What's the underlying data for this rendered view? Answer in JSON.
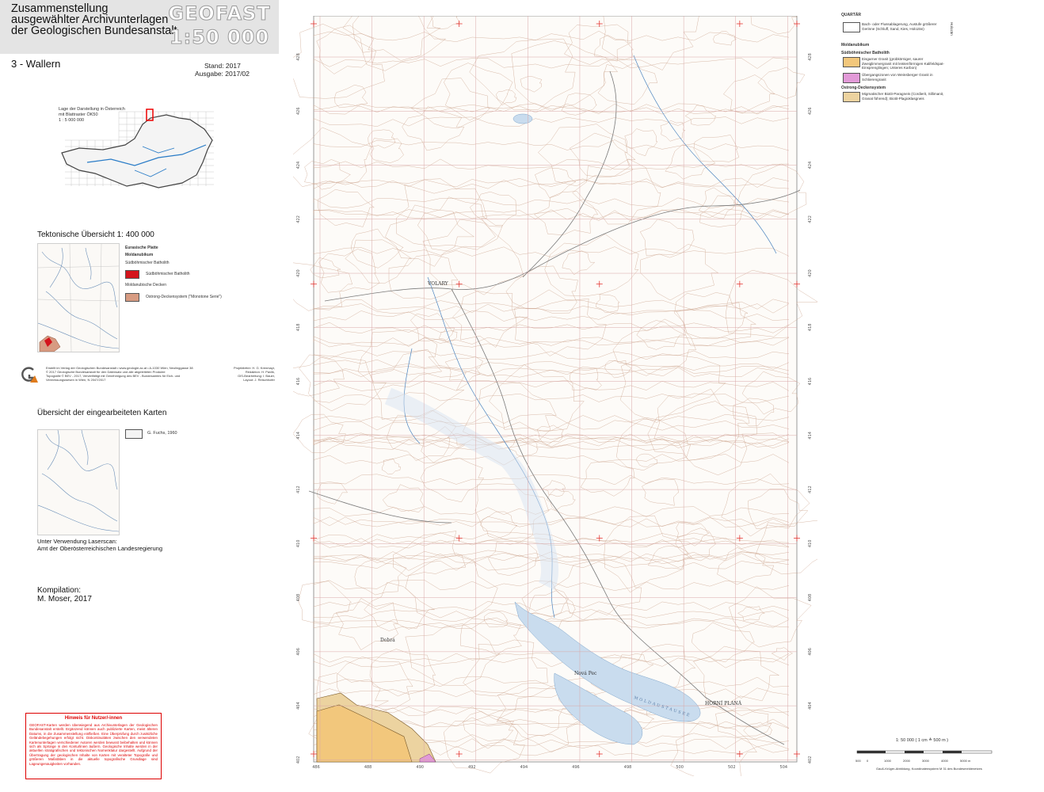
{
  "header": {
    "title_lines": [
      "Zusammenstellung",
      "ausgewählter Archivunterlagen",
      "der Geologischen Bundesanstalt"
    ],
    "brand_top": "GEOFAST",
    "brand_bottom": "1:50 000"
  },
  "sheet": {
    "name": "3 - Wallern",
    "stand": "Stand: 2017",
    "ausgabe": "Ausgabe: 2017/02"
  },
  "location_map": {
    "caption_lines": [
      "Lage der Darstellung in Österreich",
      "mit Blattraster ÖK50",
      "1 : 5 000 000"
    ]
  },
  "tectonic": {
    "title": "Tektonische Übersicht  1: 400 000",
    "legend": [
      {
        "label": "Eurasische Platte",
        "kind": "heading"
      },
      {
        "label": "Moldanubikum",
        "kind": "heading"
      },
      {
        "label": "Südböhmischer Batholith",
        "kind": "sub"
      },
      {
        "label": "Südböhmischer Batholith",
        "kind": "swatch",
        "color": "#d4141c"
      },
      {
        "label": "Moldanubische Decken",
        "kind": "sub"
      },
      {
        "label": "Ostrong-Deckensystem (\"Monotone Serie\")",
        "kind": "swatch",
        "color": "#d79b82"
      }
    ]
  },
  "imprint": {
    "left_lines": [
      "Erstellt im Verlag der Geologischen Bundesanstalt • www.geologie.ac.at • A-1030 Wien, Neulinggasse 38",
      "© 2017 Geologische Bundesanstalt für den Datensatz und alle abgeleiteten Produkte",
      "Topografie © BEV - 2017, Vervielfältigt mit Genehmigung des BEV - Bundesamtes für Eich- und",
      "Vermessungswesen in Wien, N 2047/2017"
    ],
    "right_lines": [
      "Projektleiter: H. G. Krenmayr,",
      "Redaktion: H. Pavlik,",
      "GIS-Bearbeitung: I. Bauer,",
      "Layout: J. Reischhofer"
    ]
  },
  "overview": {
    "title": "Übersicht der eingearbeiteten Karten",
    "legend_label": "G. Fuchs, 1960",
    "laser_lines": [
      "Unter Verwendung Laserscan:",
      "Amt der Oberösterreichischen Landesregierung"
    ]
  },
  "compilation": {
    "label": "Kompilation:",
    "author": "M. Moser, 2017"
  },
  "notice": {
    "title": "Hinweis für Nutzer/-innen",
    "body": "GEOFAST-Karten werden überwiegend aus Archivunterlagen der Geologischen Bundesanstalt erstellt. Ergänzend können auch publizierte Karten, meist älteren Datums, in die Zusammenstellung einfließen. Eine Überprüfung durch zusätzliche Geländebegehungen erfolgt nicht. Diskontinuitäten zwischen den verwendeten Kartenunterlagen verschiedener Autoren werden bewusst beibehalten und können sich als Sprünge in den Konturlinien äußern. Geologische Inhalte werden in der aktuellen stratigrafischen und tektonischen Nomenklatur dargestellt. Aufgrund der Übertragung der geologischen Inhalte von Karten mit veralteter Topografie und größeren Maßstäben in die aktuelle topografische Grundlage sind Lageungenauigkeiten vorhanden."
  },
  "map": {
    "easting_labels": [
      "486",
      "488",
      "490",
      "492",
      "494",
      "496",
      "498",
      "500",
      "502",
      "504"
    ],
    "northing_labels": [
      "428",
      "426",
      "424",
      "422",
      "420",
      "418",
      "416",
      "414",
      "412",
      "410",
      "408",
      "406",
      "404",
      "402"
    ],
    "place_names": [
      "VOLARY",
      "HORNÍ PLANÁ",
      "MOLDAUSTAUSEE",
      "Nová Pec",
      "Dobrá"
    ]
  },
  "legend": {
    "quartar_title": "QUARTÄR",
    "quartar_item": "Bach- oder Flussablagerung, Austufe größerer Gerinne (Schluff, Sand, Kies, Holozän)",
    "quartar_side": "Holozän",
    "moldanubikum_title": "Moldanubikum",
    "batholith_title": "Südböhmischer Batholith",
    "items": [
      {
        "label": "Eisgarner Granit (grobkörniger, saurer Zweiglimmergranit mit leistenförmigen Kalifeldspat-Einsprenglingen; Unteres Karbon)",
        "color": "#f2c77c"
      },
      {
        "label": "Übergangszonen von Weinsberger Granit in Schlierengranit",
        "color": "#e29ad8"
      },
      {
        "label": "Migmatischer Biotit-Paragneis (Cordierit, Sillimanit, Granat führend); Biotit-Plagioklasgneis",
        "color": "#ecd3a0"
      }
    ],
    "ostrong_title": "Ostrong-Deckensystem",
    "colors": {
      "quartar": "#ffffff",
      "contour": "#b08068",
      "water": "#bcd6ee",
      "grid": "#d9a7a7",
      "cross": "#e53935"
    }
  },
  "scale": {
    "text": "1: 50 000    ( 1 cm  ≙  500 m )",
    "ticks": [
      "500",
      "0",
      "1000",
      "2000",
      "3000",
      "4000",
      "5000 m"
    ],
    "projection": "Gauß-Krüger-Abbildung, Koordinatensystem M 31 des Bundesmeldenetzes"
  }
}
